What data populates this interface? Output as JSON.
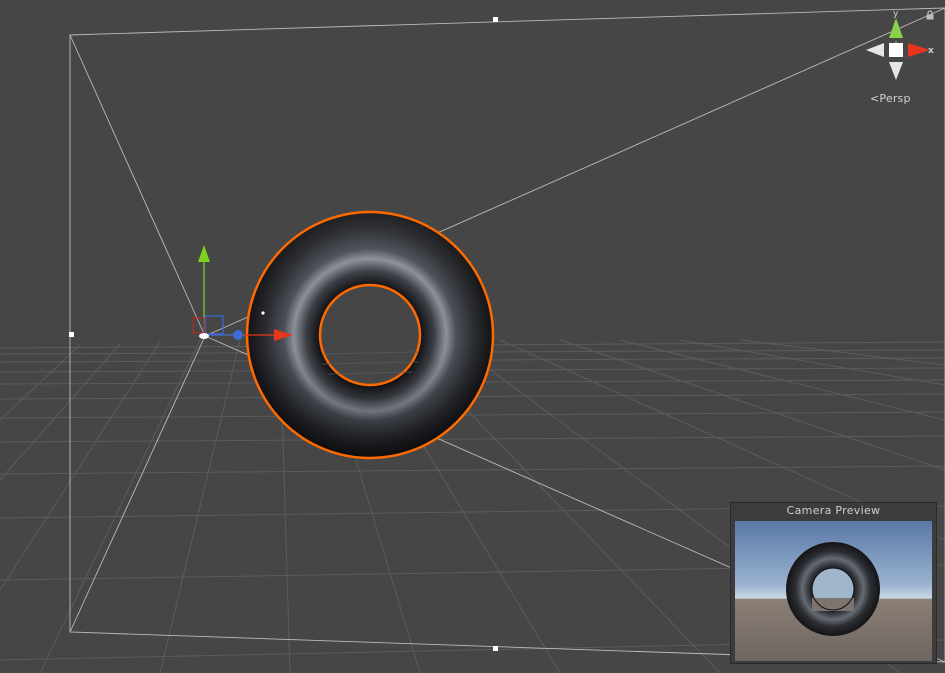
{
  "scene_view": {
    "projection_label": "Persp",
    "projection_icon": "chevron-left-icon",
    "lock_icon": "lock-icon",
    "gizmo": {
      "y_label": "y",
      "x_label": "x",
      "y_color": "#8ad14a",
      "x_color": "#e8351e",
      "z_color": "#cfcfcf"
    },
    "selection_outline_color": "#ff6a00"
  },
  "camera_preview": {
    "title": "Camera Preview"
  },
  "colors": {
    "background": "#464646",
    "grid": "#5a5a5a",
    "frustum": "#c8c8c8",
    "move_y_handle": "#7ed321",
    "move_x_handle": "#e8351e",
    "move_z_handle": "#3a6cd6"
  }
}
